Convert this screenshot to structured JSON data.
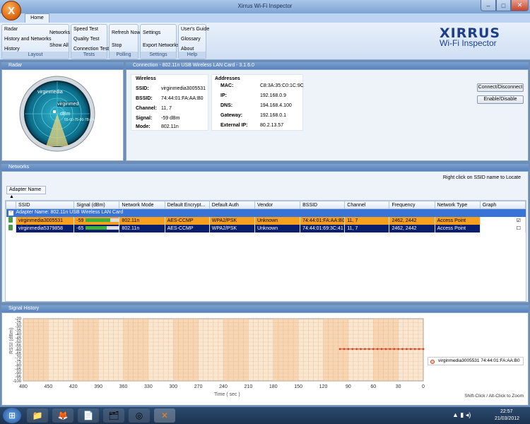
{
  "window": {
    "title": "Xirrus Wi-Fi Inspector",
    "min": "–",
    "max": "□",
    "close": "✕"
  },
  "app_icon": "X",
  "ribbon": {
    "tab": "Home",
    "groups": {
      "layout": {
        "caption": "Layout",
        "items": [
          "Radar",
          "History and Networks",
          "History",
          "Networks",
          "Show All"
        ]
      },
      "tests": {
        "caption": "Tests",
        "items": [
          "Speed Test",
          "Quality Test",
          "Connection Test"
        ]
      },
      "polling": {
        "caption": "Polling",
        "items": [
          "Refresh Now",
          "Stop"
        ]
      },
      "settings": {
        "caption": "Settings",
        "items": [
          "Settings",
          "Export Networks"
        ]
      },
      "help": {
        "caption": "Help",
        "items": [
          "User's Guide",
          "Glossary",
          "About"
        ]
      }
    },
    "logo": {
      "brand": "XIRRUS",
      "product": "Wi-Fi Inspector"
    }
  },
  "radar": {
    "header": "Radar",
    "ssid": "virginmedia",
    "center_label": "virginmed",
    "dbm": "dBm",
    "bssid_partial": "55-60-75-00-7B-0A"
  },
  "connection": {
    "header": "Connection - 802.11n USB Wireless LAN Card - 3.1.6.0",
    "wireless": {
      "title": "Wireless",
      "rows": [
        {
          "label": "SSID:",
          "value": "virginmedia3005531"
        },
        {
          "label": "BSSID:",
          "value": "74:44:01:FA:AA:B0"
        },
        {
          "label": "Channel:",
          "value": "11, 7"
        },
        {
          "label": "Signal:",
          "value": "-59 dBm"
        },
        {
          "label": "Mode:",
          "value": "802.11n"
        }
      ]
    },
    "addresses": {
      "title": "Addresses",
      "rows": [
        {
          "label": "MAC:",
          "value": "C8:3A:35:C0:1C:9C"
        },
        {
          "label": "IP:",
          "value": "192.168.0.9"
        },
        {
          "label": "DNS:",
          "value": "194.168.4.100"
        },
        {
          "label": "Gateway:",
          "value": "192.168.0.1"
        },
        {
          "label": "External IP:",
          "value": "80.2.13.57"
        }
      ]
    },
    "buttons": {
      "connect": "Connect/Disconnect",
      "enable": "Enable/Disable"
    }
  },
  "networks": {
    "header": "Networks",
    "hint": "Right click on SSID name to Locate",
    "group_by": "Adapter Name ▲",
    "columns": [
      "SSID",
      "Signal (dBm)",
      "Network Mode",
      "Default Encrypt...",
      "Default Auth",
      "Vendor",
      "BSSID",
      "Channel",
      "Frequency",
      "Network Type",
      "Graph"
    ],
    "adapter_row": "Adapter Name: 802.11n USB Wireless LAN Card",
    "rows": [
      {
        "ssid": "virginmedia3005531",
        "signal": "-59",
        "signal_fraction": 0.7,
        "mode": "802.11n",
        "encrypt": "AES-CCMP",
        "auth": "WPA2/PSK",
        "vendor": "Unknown",
        "bssid": "74:44:01:FA:AA:B0",
        "channel": "11, 7",
        "freq": "2462, 2442",
        "type": "Access Point",
        "graph": "☑"
      },
      {
        "ssid": "virginmedia5379858",
        "signal": "-65",
        "signal_fraction": 0.6,
        "mode": "802.11n",
        "encrypt": "AES-CCMP",
        "auth": "WPA2/PSK",
        "vendor": "Unknown",
        "bssid": "74:44:01:69:3C:41",
        "channel": "11, 7",
        "freq": "2462, 2442",
        "type": "Access Point",
        "graph": "☐"
      }
    ]
  },
  "signal_history": {
    "header": "Signal History",
    "ylabel": "RSSI (dBm)",
    "xlabel": "Time ( sec )",
    "y_ticks": [
      "-20",
      "-25",
      "-30",
      "-35",
      "-40",
      "-45",
      "-50",
      "-55",
      "-60",
      "-65",
      "-70",
      "-75",
      "-80",
      "-85",
      "-90",
      "-95",
      "-100"
    ],
    "x_ticks": [
      "480",
      "450",
      "420",
      "390",
      "360",
      "330",
      "300",
      "270",
      "240",
      "210",
      "180",
      "150",
      "120",
      "90",
      "60",
      "30",
      "0"
    ],
    "legend": "virginmedia3005531 74:44:01:FA:AA:B0",
    "zoom_hint": "Shift-Click / Alt-Click to Zoom",
    "series_color": "#d94020"
  },
  "chart_data": {
    "type": "line",
    "xlabel": "Time ( sec )",
    "ylabel": "RSSI (dBm)",
    "xlim": [
      480,
      0
    ],
    "ylim": [
      -100,
      -20
    ],
    "series": [
      {
        "name": "virginmedia3005531 74:44:01:FA:AA:B0",
        "x": [
          100,
          95,
          90,
          85,
          80,
          75,
          70,
          65,
          60,
          55,
          50,
          45,
          40,
          35,
          30,
          25,
          20,
          15,
          10,
          5,
          0
        ],
        "values": [
          -59,
          -59,
          -59,
          -59,
          -59,
          -59,
          -59,
          -59,
          -59,
          -59,
          -59,
          -59,
          -59,
          -59,
          -59,
          -59,
          -59,
          -59,
          -59,
          -59,
          -59
        ]
      }
    ]
  },
  "taskbar": {
    "time": "22:57",
    "date": "21/03/2012"
  }
}
